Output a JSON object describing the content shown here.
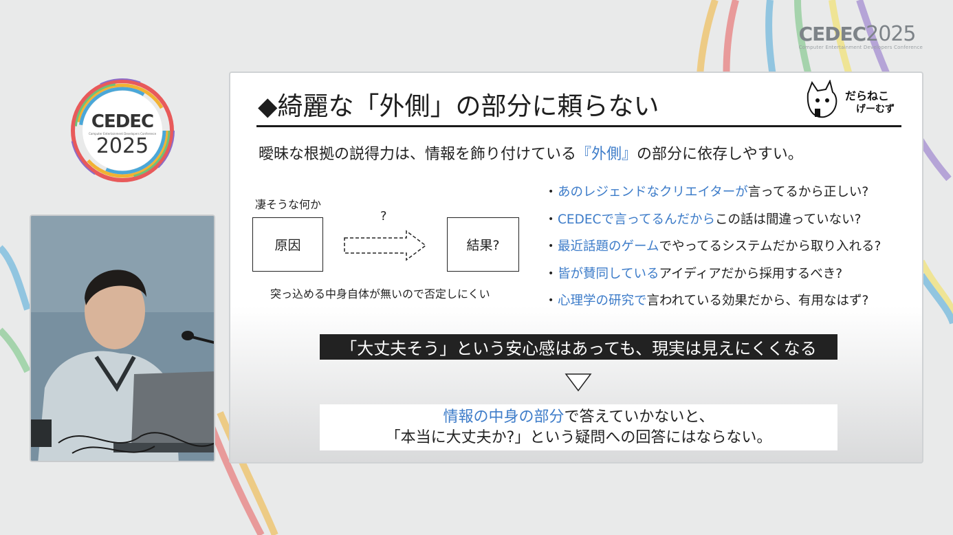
{
  "event_logo": {
    "brand": "CEDEC",
    "year": "2025",
    "tagline": "Computer Entertainment Developers Conference"
  },
  "badge_logo": {
    "brand": "CEDEC",
    "tagline": "Computer Entertainment Developers Conference",
    "year": "2025"
  },
  "slide": {
    "title": "◆綺麗な「外側」の部分に頼らない",
    "brand_logo": {
      "line1": "だらねこ",
      "line2": "げーむず"
    },
    "lead": {
      "before": "曖昧な根拠の説得力は、情報を飾り付けている",
      "highlight": "『外側』",
      "after": "の部分に依存しやすい。"
    },
    "diagram": {
      "top_label": "凄そうな何か",
      "cause": "原因",
      "question": "?",
      "result": "結果?",
      "caption": "突っ込める中身自体が無いので否定しにくい"
    },
    "bullets": [
      {
        "highlight": "あのレジェンドなクリエイターが",
        "rest": "言ってるから正しい?"
      },
      {
        "highlight": "CEDECで言ってるんだから",
        "rest": "この話は間違っていない?"
      },
      {
        "highlight": "最近話題のゲーム",
        "rest": "でやってるシステムだから取り入れる?"
      },
      {
        "highlight": "皆が賛同している",
        "rest": "アイディアだから採用するべき?"
      },
      {
        "highlight": "心理学の研究で",
        "rest": "言われている効果だから、有用なはず?"
      }
    ],
    "banner": "「大丈夫そう」という安心感はあっても、現実は見えにくくなる",
    "answer": {
      "highlight": "情報の中身の部分",
      "line1_rest": "で答えていかないと、",
      "line2": "「本当に大丈夫か?」という疑問への回答にはならない。"
    }
  },
  "colors": {
    "accent_blue": "#3d7cc9",
    "banner_bg": "#222222",
    "stripe_colors": [
      "#e85a5a",
      "#f2b233",
      "#f5e050",
      "#6ec27a",
      "#4aa7d8",
      "#8c6bc8"
    ]
  }
}
